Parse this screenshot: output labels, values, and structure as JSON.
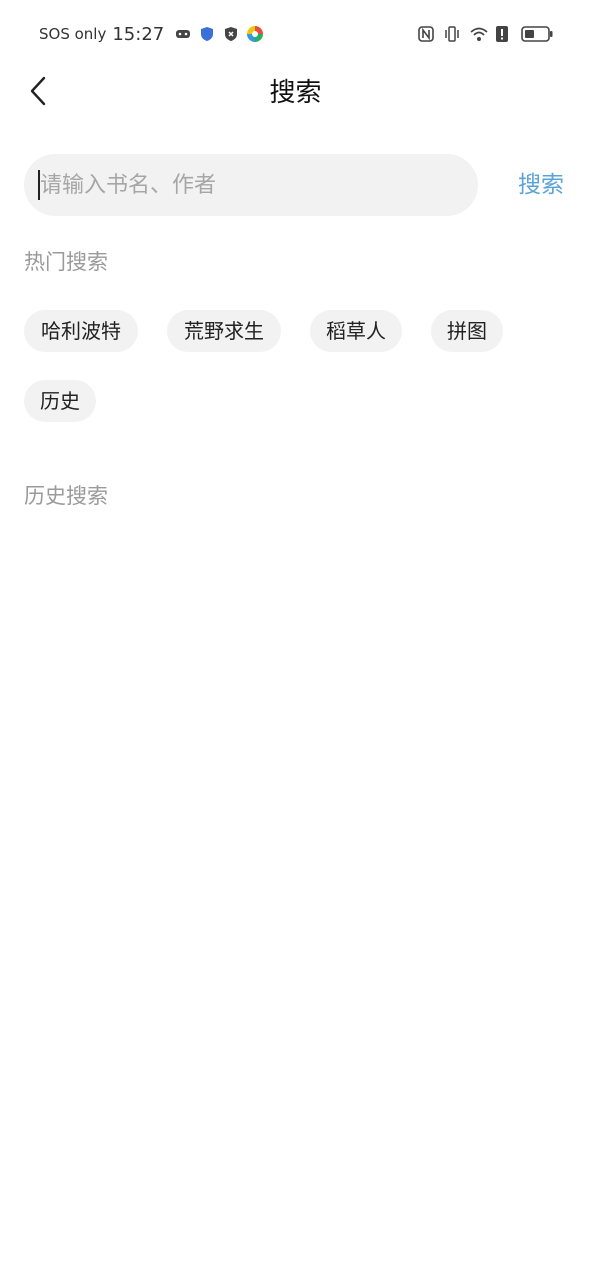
{
  "status_bar": {
    "carrier": "SOS only",
    "time": "15:27",
    "left_icons": [
      "game-controller-icon",
      "shield-icon",
      "security-icon",
      "color-wheel-icon"
    ],
    "right_icons": [
      "nfc-icon",
      "vibrate-icon",
      "wifi-icon",
      "alert-icon",
      "battery-icon"
    ]
  },
  "header": {
    "title": "搜索",
    "back_icon": "chevron-left-icon"
  },
  "search": {
    "placeholder": "请输入书名、作者",
    "value": "",
    "button_label": "搜索",
    "button_color": "#5aa3d6"
  },
  "hot": {
    "title": "热门搜索",
    "tags": [
      "哈利波特",
      "荒野求生",
      "稻草人",
      "拼图",
      "历史"
    ]
  },
  "history": {
    "title": "历史搜索",
    "items": []
  }
}
